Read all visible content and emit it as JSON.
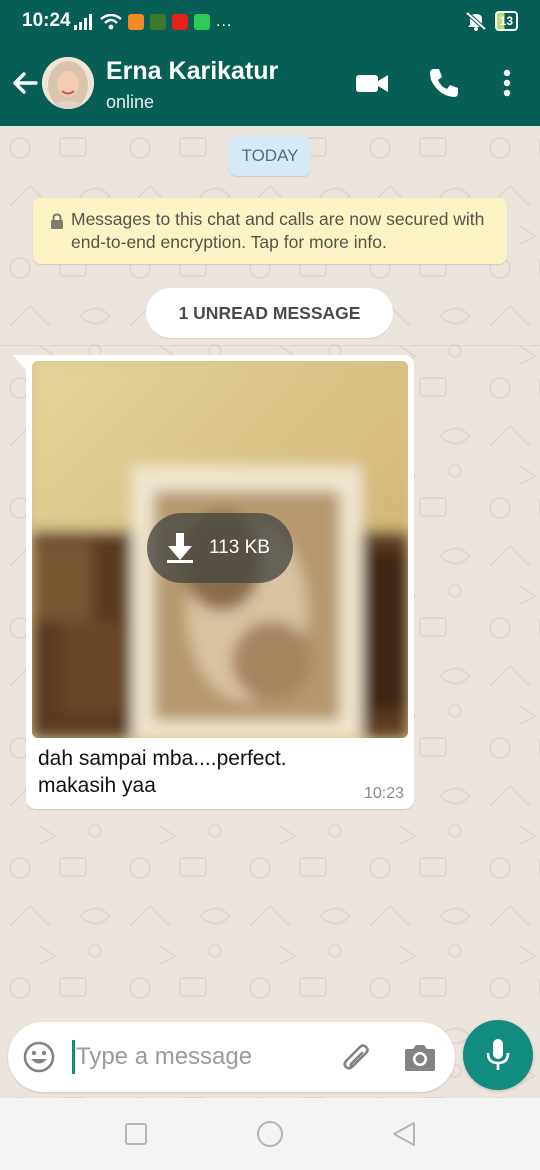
{
  "status_bar": {
    "time": "10:24",
    "battery": "13",
    "more_icon": "..."
  },
  "header": {
    "contact_name": "Erna Karikatur",
    "contact_status": "online",
    "icons": [
      "back-arrow-icon",
      "video-call-icon",
      "voice-call-icon",
      "more-vert-icon"
    ]
  },
  "chat": {
    "date_chip": "TODAY",
    "encryption_notice": "Messages to this chat and calls are now secured with end-to-end encryption. Tap for more info.",
    "unread_label": "1 UNREAD MESSAGE",
    "messages": [
      {
        "type": "image",
        "download_size": "113 KB",
        "caption_line1": "dah sampai mba....perfect.",
        "caption_line2": "makasih yaa",
        "time": "10:23"
      }
    ]
  },
  "composer": {
    "placeholder": "Type a message",
    "icons": [
      "emoji-icon",
      "attach-icon",
      "camera-icon",
      "mic-icon"
    ]
  },
  "colors": {
    "header": "#075e54",
    "accent": "#128c7e",
    "chat_bg": "#ece5dd",
    "encryption_bg": "#fdf4c5",
    "date_chip_bg": "#d5eaf4"
  }
}
